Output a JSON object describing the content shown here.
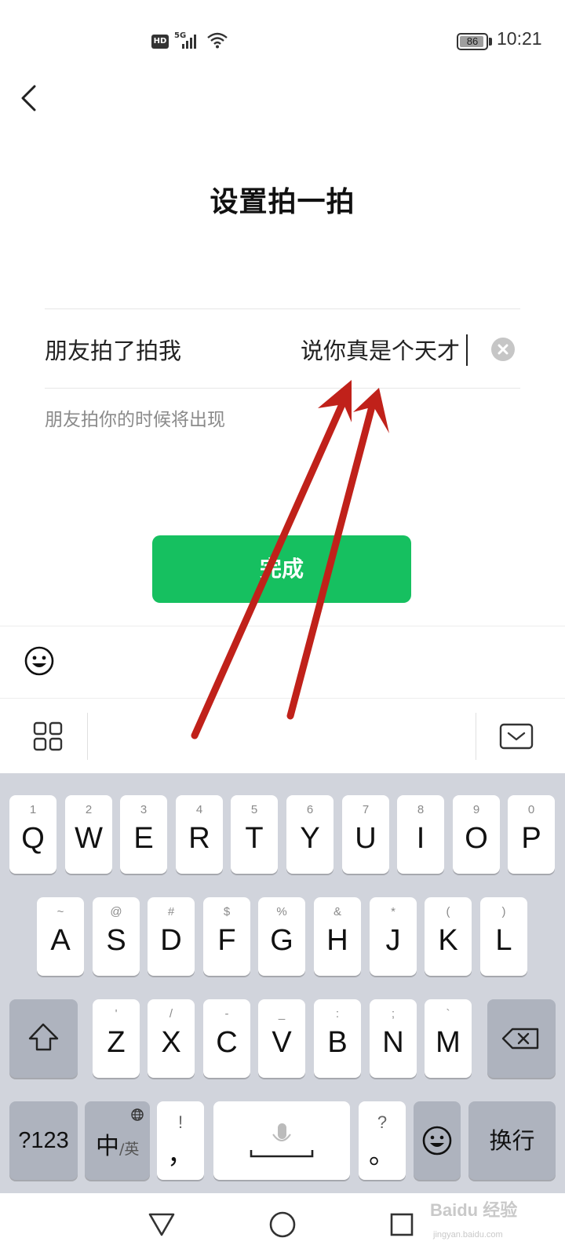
{
  "status_bar": {
    "hd": "HD",
    "network": "5G",
    "battery": "86",
    "time": "10:21"
  },
  "header": {
    "back_icon": "chevron-left-icon",
    "title": "设置拍一拍"
  },
  "field": {
    "label": "朋友拍了拍我",
    "value": "说你真是个天才",
    "clear_icon": "clear-x-icon"
  },
  "hint": "朋友拍你的时候将出现",
  "done_button": "完成",
  "emoji_bar": {
    "icon": "smiley-icon"
  },
  "toolbar": {
    "left_icon": "grid-menu-icon",
    "right_icon": "keyboard-hide-icon"
  },
  "keyboard": {
    "row1": [
      {
        "hint": "1",
        "label": "Q"
      },
      {
        "hint": "2",
        "label": "W"
      },
      {
        "hint": "3",
        "label": "E"
      },
      {
        "hint": "4",
        "label": "R"
      },
      {
        "hint": "5",
        "label": "T"
      },
      {
        "hint": "6",
        "label": "Y"
      },
      {
        "hint": "7",
        "label": "U"
      },
      {
        "hint": "8",
        "label": "I"
      },
      {
        "hint": "9",
        "label": "O"
      },
      {
        "hint": "0",
        "label": "P"
      }
    ],
    "row2": [
      {
        "hint": "~",
        "label": "A"
      },
      {
        "hint": "@",
        "label": "S"
      },
      {
        "hint": "#",
        "label": "D"
      },
      {
        "hint": "$",
        "label": "F"
      },
      {
        "hint": "%",
        "label": "G"
      },
      {
        "hint": "&",
        "label": "H"
      },
      {
        "hint": "*",
        "label": "J"
      },
      {
        "hint": "(",
        "label": "K"
      },
      {
        "hint": ")",
        "label": "L"
      }
    ],
    "row3": [
      {
        "hint": "'",
        "label": "Z"
      },
      {
        "hint": "/",
        "label": "X"
      },
      {
        "hint": "-",
        "label": "C"
      },
      {
        "hint": "_",
        "label": "V"
      },
      {
        "hint": ":",
        "label": "B"
      },
      {
        "hint": ";",
        "label": "N"
      },
      {
        "hint": "`",
        "label": "M"
      }
    ],
    "shift_icon": "shift-arrow-icon",
    "backspace_icon": "backspace-icon",
    "numbers_label": "?123",
    "lang_main": "中",
    "lang_alt": "/英",
    "lang_icon": "globe-icon",
    "comma_hint": "!",
    "comma_label": "，",
    "space_icon": "microphone-icon",
    "period_hint": "?",
    "period_label": "。",
    "emoji_icon": "smiley-icon",
    "enter_label": "换行"
  },
  "nav_bar": {
    "back": "triangle-back-icon",
    "home": "circle-home-icon",
    "recents": "square-recents-icon"
  },
  "watermark": {
    "text": "Baidu 经验",
    "sub": "jingyan.baidu.com"
  },
  "annotation": {
    "color": "#c0211a",
    "icon": "red-arrow-icon"
  }
}
